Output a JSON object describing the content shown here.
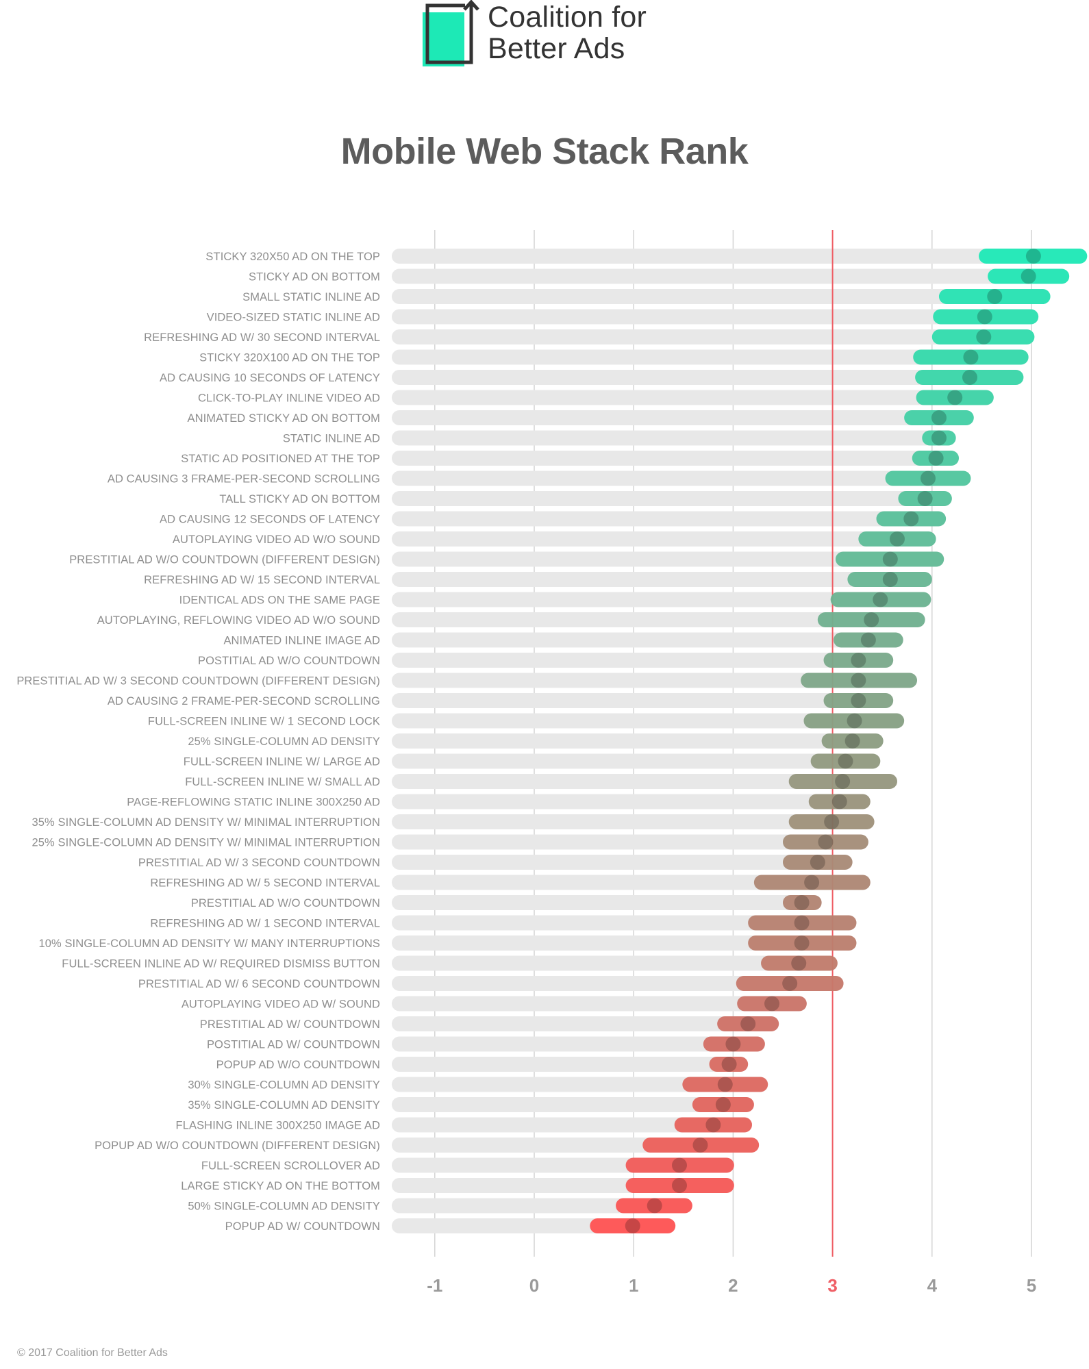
{
  "logo": {
    "line1": "Coalition for",
    "line2": "Better Ads",
    "accent_color": "#1de9b6",
    "frame_color": "#333333"
  },
  "footer": "© 2017 Coalition for Better Ads",
  "chart_data": {
    "type": "range-dot",
    "title": "Mobile Web Stack Rank",
    "xlabel": "",
    "ylabel": "",
    "xlim": [
      -1,
      5.6
    ],
    "xticks": [
      -1,
      0,
      1,
      2,
      3,
      4,
      5
    ],
    "reference_line": 3,
    "reference_color": "#ef5f66",
    "grid": true,
    "legend": "none",
    "color_top": "#1de9b6",
    "color_mid": "#8c9d82",
    "color_bottom": "#ff5252",
    "track_color": "#e8e8e8",
    "categories": [
      "STICKY 320X50 AD ON THE TOP",
      "STICKY AD ON BOTTOM",
      "SMALL STATIC INLINE AD",
      "VIDEO-SIZED STATIC INLINE AD",
      "REFRESHING AD W/ 30 SECOND INTERVAL",
      "STICKY 320X100 AD ON THE TOP",
      "AD CAUSING 10 SECONDS OF LATENCY",
      "CLICK-TO-PLAY INLINE VIDEO AD",
      "ANIMATED STICKY AD ON BOTTOM",
      "STATIC INLINE AD",
      "STATIC AD POSITIONED AT THE TOP",
      "AD CAUSING 3 FRAME-PER-SECOND SCROLLING",
      "TALL STICKY AD ON BOTTOM",
      "AD CAUSING 12 SECONDS OF LATENCY",
      "AUTOPLAYING VIDEO AD W/O SOUND",
      "PRESTITIAL AD W/O COUNTDOWN (DIFFERENT DESIGN)",
      "REFRESHING AD W/ 15 SECOND INTERVAL",
      "IDENTICAL ADS ON THE SAME PAGE",
      "AUTOPLAYING, REFLOWING VIDEO AD W/O SOUND",
      "ANIMATED INLINE IMAGE AD",
      "POSTITIAL AD W/O COUNTDOWN",
      "PRESTITIAL AD W/ 3 SECOND COUNTDOWN (DIFFERENT DESIGN)",
      "AD CAUSING 2 FRAME-PER-SECOND SCROLLING",
      "FULL-SCREEN INLINE W/ 1 SECOND LOCK",
      "25% SINGLE-COLUMN AD DENSITY",
      "FULL-SCREEN INLINE W/ LARGE AD",
      "FULL-SCREEN INLINE W/ SMALL AD",
      "PAGE-REFLOWING STATIC INLINE 300X250 AD",
      "35% SINGLE-COLUMN AD DENSITY W/ MINIMAL INTERRUPTION",
      "25% SINGLE-COLUMN AD DENSITY W/ MINIMAL INTERRUPTION",
      "PRESTITIAL AD W/ 3 SECOND COUNTDOWN",
      "REFRESHING AD W/ 5 SECOND INTERVAL",
      "PRESTITIAL AD W/O COUNTDOWN",
      "REFRESHING AD W/ 1 SECOND INTERVAL",
      "10% SINGLE-COLUMN AD DENSITY W/ MANY INTERRUPTIONS",
      "FULL-SCREEN INLINE AD W/ REQUIRED DISMISS BUTTON",
      "PRESTITIAL AD W/ 6 SECOND COUNTDOWN",
      "AUTOPLAYING VIDEO AD W/ SOUND",
      "PRESTITIAL AD W/ COUNTDOWN",
      "POSTITIAL AD W/ COUNTDOWN",
      "POPUP AD W/O COUNTDOWN",
      "30% SINGLE-COLUMN AD DENSITY",
      "35% SINGLE-COLUMN AD DENSITY",
      "FLASHING INLINE 300X250 IMAGE AD",
      "POPUP AD W/O COUNTDOWN (DIFFERENT DESIGN)",
      "FULL-SCREEN SCROLLOVER AD",
      "LARGE STICKY AD ON THE BOTTOM",
      "50% SINGLE-COLUMN AD DENSITY",
      "POPUP AD W/ COUNTDOWN"
    ],
    "series": [
      {
        "name": "mean",
        "values": [
          5.02,
          4.97,
          4.63,
          4.53,
          4.52,
          4.39,
          4.38,
          4.23,
          4.07,
          4.07,
          4.04,
          3.96,
          3.93,
          3.79,
          3.65,
          3.58,
          3.58,
          3.48,
          3.39,
          3.36,
          3.26,
          3.26,
          3.26,
          3.22,
          3.2,
          3.13,
          3.1,
          3.07,
          2.99,
          2.93,
          2.85,
          2.79,
          2.69,
          2.69,
          2.69,
          2.66,
          2.57,
          2.39,
          2.15,
          2.0,
          1.96,
          1.92,
          1.9,
          1.8,
          1.67,
          1.46,
          1.46,
          1.21,
          0.99
        ]
      },
      {
        "name": "low",
        "values": [
          4.47,
          4.56,
          4.07,
          4.01,
          4.0,
          3.81,
          3.83,
          3.84,
          3.72,
          3.9,
          3.8,
          3.53,
          3.66,
          3.44,
          3.26,
          3.03,
          3.15,
          2.98,
          2.85,
          3.01,
          2.91,
          2.68,
          2.91,
          2.71,
          2.89,
          2.78,
          2.56,
          2.76,
          2.56,
          2.5,
          2.5,
          2.21,
          2.5,
          2.15,
          2.15,
          2.28,
          2.03,
          2.04,
          1.84,
          1.7,
          1.76,
          1.49,
          1.59,
          1.41,
          1.09,
          0.92,
          0.92,
          0.82,
          0.56
        ]
      },
      {
        "name": "high",
        "values": [
          5.56,
          5.38,
          5.19,
          5.07,
          5.03,
          4.97,
          4.92,
          4.62,
          4.42,
          4.24,
          4.27,
          4.39,
          4.2,
          4.14,
          4.04,
          4.12,
          4.0,
          3.99,
          3.93,
          3.71,
          3.61,
          3.85,
          3.61,
          3.72,
          3.51,
          3.48,
          3.65,
          3.38,
          3.42,
          3.36,
          3.2,
          3.38,
          2.89,
          3.24,
          3.24,
          3.05,
          3.11,
          2.74,
          2.46,
          2.32,
          2.15,
          2.35,
          2.21,
          2.19,
          2.26,
          2.01,
          2.01,
          1.59,
          1.42
        ]
      }
    ]
  }
}
